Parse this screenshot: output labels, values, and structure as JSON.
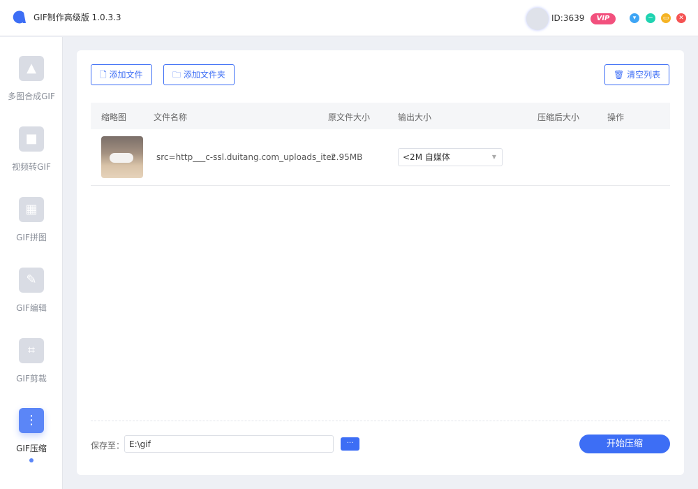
{
  "app": {
    "title": "GIF制作高级版 1.0.3.3",
    "user_id": "ID:3639",
    "vip": "VIP"
  },
  "window_controls": {
    "menu": "▾",
    "minimize": "−",
    "maximize": "▭",
    "close": "✕"
  },
  "sidebar": {
    "items": [
      {
        "label": "多图合成GIF",
        "icon": "▲"
      },
      {
        "label": "视频转GIF",
        "icon": "■"
      },
      {
        "label": "GIF拼图",
        "icon": "▦"
      },
      {
        "label": "GIF编辑",
        "icon": "✎"
      },
      {
        "label": "GIF剪裁",
        "icon": "⌗"
      },
      {
        "label": "GIF压缩",
        "icon": "⋮"
      }
    ]
  },
  "toolbar": {
    "add_file": "添加文件",
    "add_folder": "添加文件夹",
    "clear_list": "清空列表"
  },
  "table": {
    "headers": [
      "缩略图",
      "文件名称",
      "原文件大小",
      "输出大小",
      "压缩后大小",
      "操作"
    ],
    "rows": [
      {
        "name": "src=http___c-ssl.duitang.com_uploads_iter",
        "size": "2.95MB",
        "output": "<2M 自媒体",
        "compressed": ""
      }
    ]
  },
  "footer": {
    "save_label": "保存至：",
    "path": "E:\\gif",
    "browse": "···",
    "start": "开始压缩"
  },
  "colors": {
    "accent": "#3d6ef5",
    "vip": "#f2507d"
  }
}
